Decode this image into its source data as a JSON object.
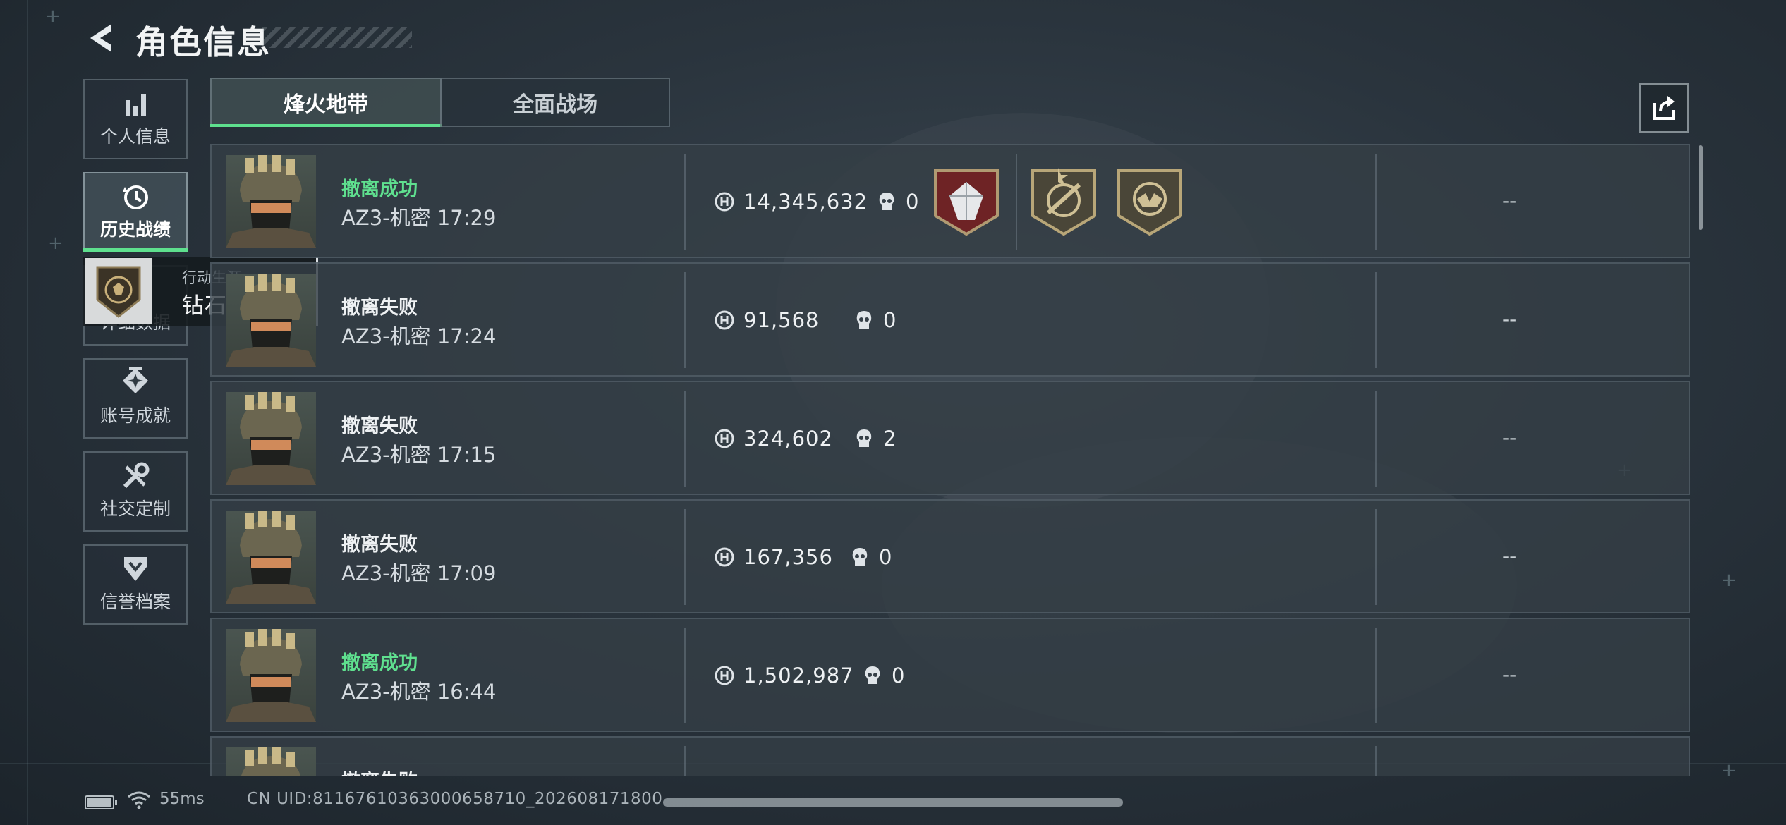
{
  "header": {
    "title": "角色信息"
  },
  "nav": [
    {
      "label": "个人信息",
      "icon": "bar-chart-icon"
    },
    {
      "label": "历史战绩",
      "icon": "history-icon",
      "active": true
    },
    {
      "label": "详细数据",
      "icon": "detail-icon"
    },
    {
      "label": "账号成就",
      "icon": "achievement-icon"
    },
    {
      "label": "社交定制",
      "icon": "tools-icon"
    },
    {
      "label": "信誉档案",
      "icon": "shield-icon"
    }
  ],
  "tooltip": {
    "caption": "行动生涯",
    "text": "钻石大亨！"
  },
  "tabs": [
    {
      "label": "烽火地带",
      "active": true
    },
    {
      "label": "全面战场",
      "active": false
    }
  ],
  "matches": [
    {
      "status": "撤离成功",
      "success": true,
      "map": "AZ3-机密 17:29",
      "value": "14,345,632",
      "kills": "0",
      "right": "--"
    },
    {
      "status": "撤离失败",
      "success": false,
      "map": "AZ3-机密 17:24",
      "value": "91,568",
      "kills": "0",
      "right": "--"
    },
    {
      "status": "撤离失败",
      "success": false,
      "map": "AZ3-机密 17:15",
      "value": "324,602",
      "kills": "2",
      "right": "--"
    },
    {
      "status": "撤离失败",
      "success": false,
      "map": "AZ3-机密 17:09",
      "value": "167,356",
      "kills": "0",
      "right": "--"
    },
    {
      "status": "撤离成功",
      "success": true,
      "map": "AZ3-机密 16:44",
      "value": "1,502,987",
      "kills": "0",
      "right": "--"
    },
    {
      "status": "撤离失败",
      "success": false,
      "map": "",
      "value": "",
      "kills": "",
      "right": ""
    }
  ],
  "medals": [
    "diamond-medal-icon",
    "rifle-medal-icon",
    "emblem-medal-icon"
  ],
  "footer": {
    "ping": "55ms",
    "uid": "CN UID:8116761036300065871​0_202608171800"
  },
  "colors": {
    "success": "#5fe08f",
    "accent": "#5ee08e",
    "text": "#eef1f3"
  }
}
